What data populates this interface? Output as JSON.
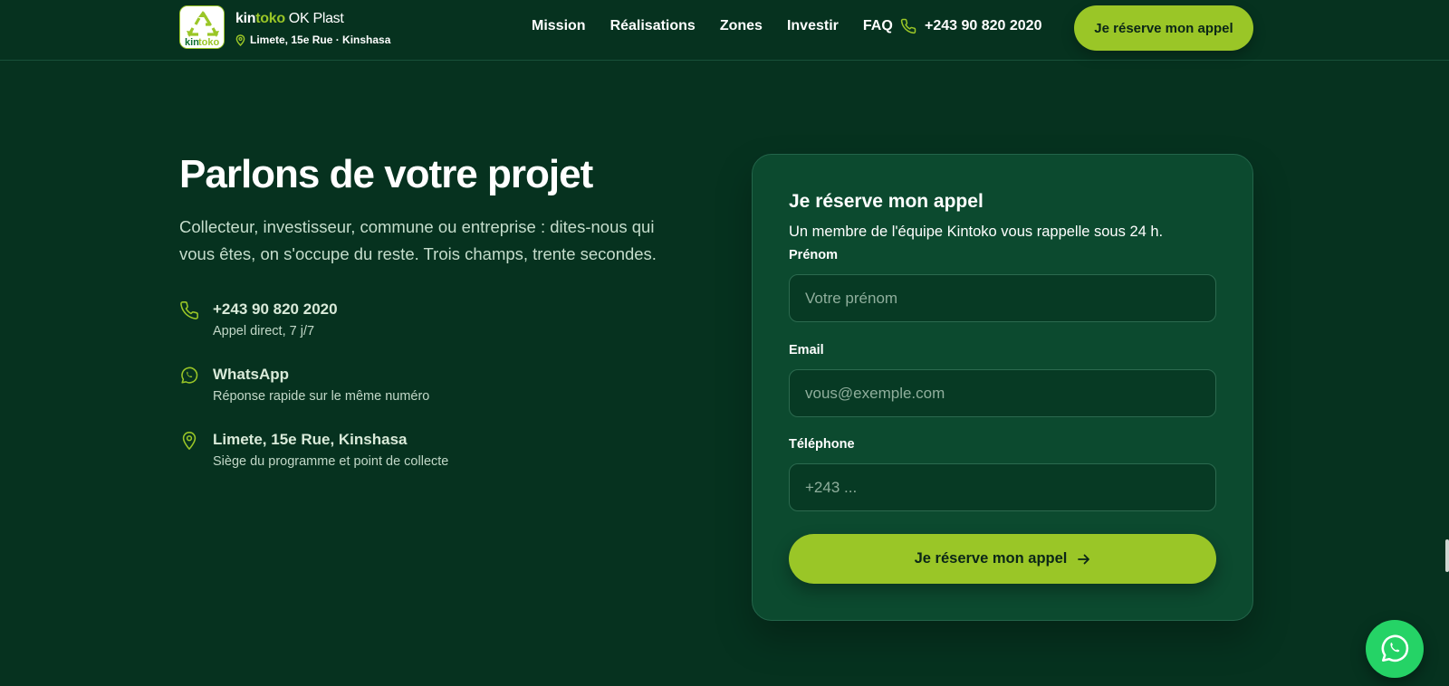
{
  "brand": {
    "name_part1": "kin",
    "name_part2": "toko",
    "name_part3": "OK Plast",
    "location": "Limete, 15e Rue · Kinshasa",
    "logo_text_part1": "kin",
    "logo_text_part2": "toko",
    "colors": {
      "accent": "#9ac627",
      "background": "#06321f",
      "card": "#0c4a2f"
    }
  },
  "nav": {
    "items": [
      {
        "label": "Mission"
      },
      {
        "label": "Réalisations"
      },
      {
        "label": "Zones"
      },
      {
        "label": "Investir"
      },
      {
        "label": "FAQ"
      }
    ],
    "phone": "+243 90 820 2020",
    "cta_label": "Je réserve mon appel"
  },
  "hero": {
    "title": "Parlons de votre projet",
    "intro": "Collecteur, investisseur, commune ou entreprise : dites-nous qui vous êtes, on s'occupe du reste. Trois champs, trente secondes."
  },
  "contacts": [
    {
      "icon": "phone-icon",
      "title": "+243 90 820 2020",
      "subtitle": "Appel direct, 7 j/7"
    },
    {
      "icon": "whatsapp-icon",
      "title": "WhatsApp",
      "subtitle": "Réponse rapide sur le même numéro"
    },
    {
      "icon": "map-pin-icon",
      "title": "Limete, 15e Rue, Kinshasa",
      "subtitle": "Siège du programme et point de collecte"
    }
  ],
  "form": {
    "title": "Je réserve mon appel",
    "subtitle": "Un membre de l'équipe Kintoko vous rappelle sous 24 h.",
    "fields": [
      {
        "label": "Prénom",
        "value": "",
        "placeholder": "Votre prénom"
      },
      {
        "label": "Email",
        "value": "",
        "placeholder": "vous@exemple.com"
      },
      {
        "label": "Téléphone",
        "value": "",
        "placeholder": "+243 ..."
      }
    ],
    "submit_label": "Je réserve mon appel"
  },
  "floating": {
    "icon": "whatsapp-icon"
  }
}
